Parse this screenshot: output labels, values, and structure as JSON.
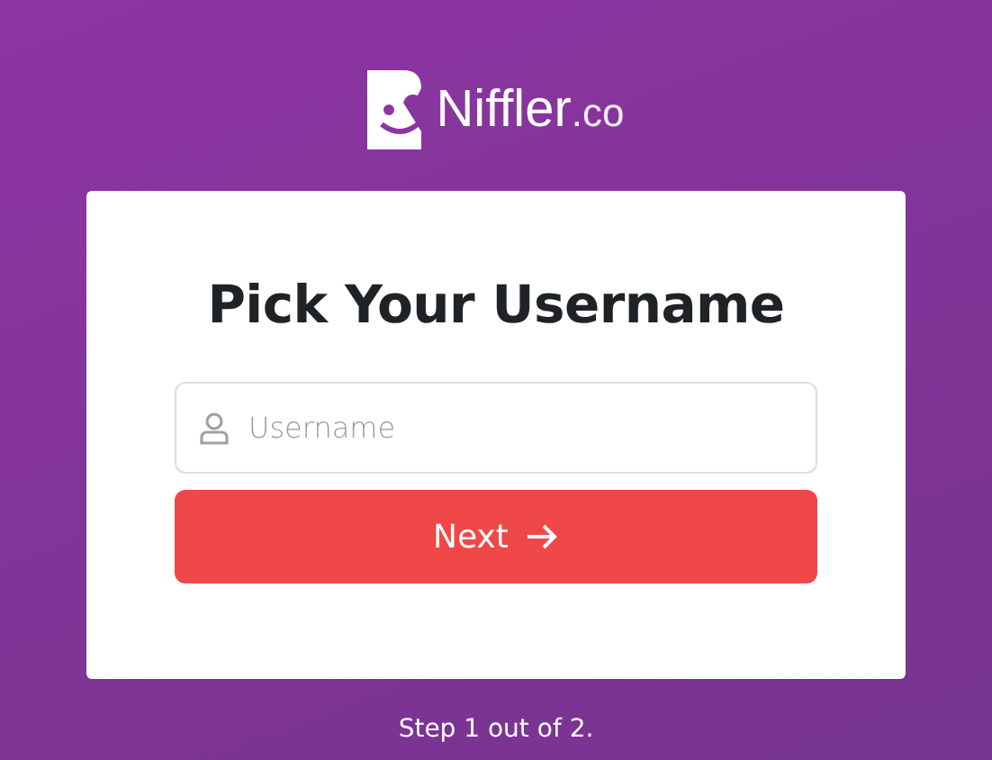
{
  "logo": {
    "name": "Niffler",
    "suffix": ".co"
  },
  "card": {
    "title": "Pick Your Username",
    "field": {
      "placeholder": "Username"
    },
    "button": {
      "label": "Next"
    }
  },
  "footer": {
    "step": "Step 1 out of 2."
  }
}
